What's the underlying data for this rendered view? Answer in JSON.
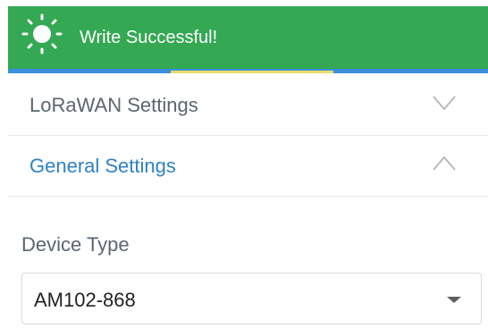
{
  "toast": {
    "message": "Write Successful!",
    "icon": "sun-icon",
    "background_color": "#34a853",
    "progress_color": "#3a8fe0"
  },
  "sections": [
    {
      "label": "LoRaWAN Settings",
      "state": "collapsed",
      "icon": "chevron-down-icon"
    },
    {
      "label": "General Settings",
      "state": "expanded",
      "icon": "chevron-up-icon",
      "color": "#2f82c3"
    }
  ],
  "device_type": {
    "label": "Device Type",
    "value": "AM102-868",
    "icon": "dropdown-arrow-icon"
  }
}
